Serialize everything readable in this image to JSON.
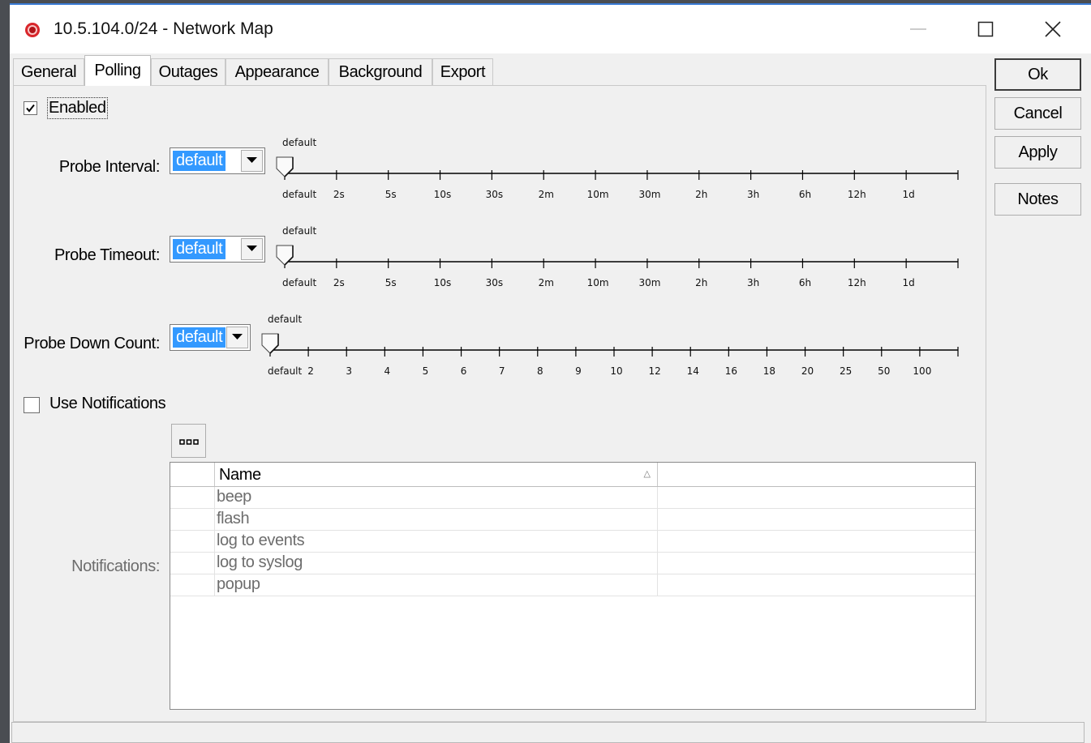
{
  "window": {
    "title": "10.5.104.0/24 - Network Map",
    "icon": "red-circle-app-icon",
    "controls": [
      "minimize-icon",
      "maximize-icon",
      "close-icon"
    ]
  },
  "tabs": [
    {
      "label": "General",
      "active": false
    },
    {
      "label": "Polling",
      "active": true
    },
    {
      "label": "Outages",
      "active": false
    },
    {
      "label": "Appearance",
      "active": false
    },
    {
      "label": "Background",
      "active": false
    },
    {
      "label": "Export",
      "active": false
    }
  ],
  "enabled": {
    "label": "Enabled",
    "checked": true
  },
  "probe_interval": {
    "label": "Probe Interval:",
    "value": "default",
    "slider_value_label": "default",
    "ticks": [
      "default",
      "2s",
      "5s",
      "10s",
      "30s",
      "2m",
      "10m",
      "30m",
      "2h",
      "3h",
      "6h",
      "12h",
      "1d"
    ]
  },
  "probe_timeout": {
    "label": "Probe Timeout:",
    "value": "default",
    "slider_value_label": "default",
    "ticks": [
      "default",
      "2s",
      "5s",
      "10s",
      "30s",
      "2m",
      "10m",
      "30m",
      "2h",
      "3h",
      "6h",
      "12h",
      "1d"
    ]
  },
  "probe_down_count": {
    "label": "Probe Down Count:",
    "value": "default",
    "slider_value_label": "default",
    "ticks": [
      "default",
      "2",
      "3",
      "4",
      "5",
      "6",
      "7",
      "8",
      "9",
      "10",
      "12",
      "14",
      "16",
      "18",
      "20",
      "25",
      "50",
      "100"
    ]
  },
  "use_notifications": {
    "label": "Use Notifications",
    "checked": false
  },
  "notifications": {
    "label": "Notifications:",
    "column_name": "Name",
    "items": [
      "beep",
      "flash",
      "log to events",
      "log to syslog",
      "popup"
    ]
  },
  "buttons": {
    "ok": "Ok",
    "cancel": "Cancel",
    "apply": "Apply",
    "notes": "Notes"
  },
  "colors": {
    "selection": "#3399ff",
    "title_accent": "#3a7bd5",
    "app_icon": "#d9262b"
  }
}
